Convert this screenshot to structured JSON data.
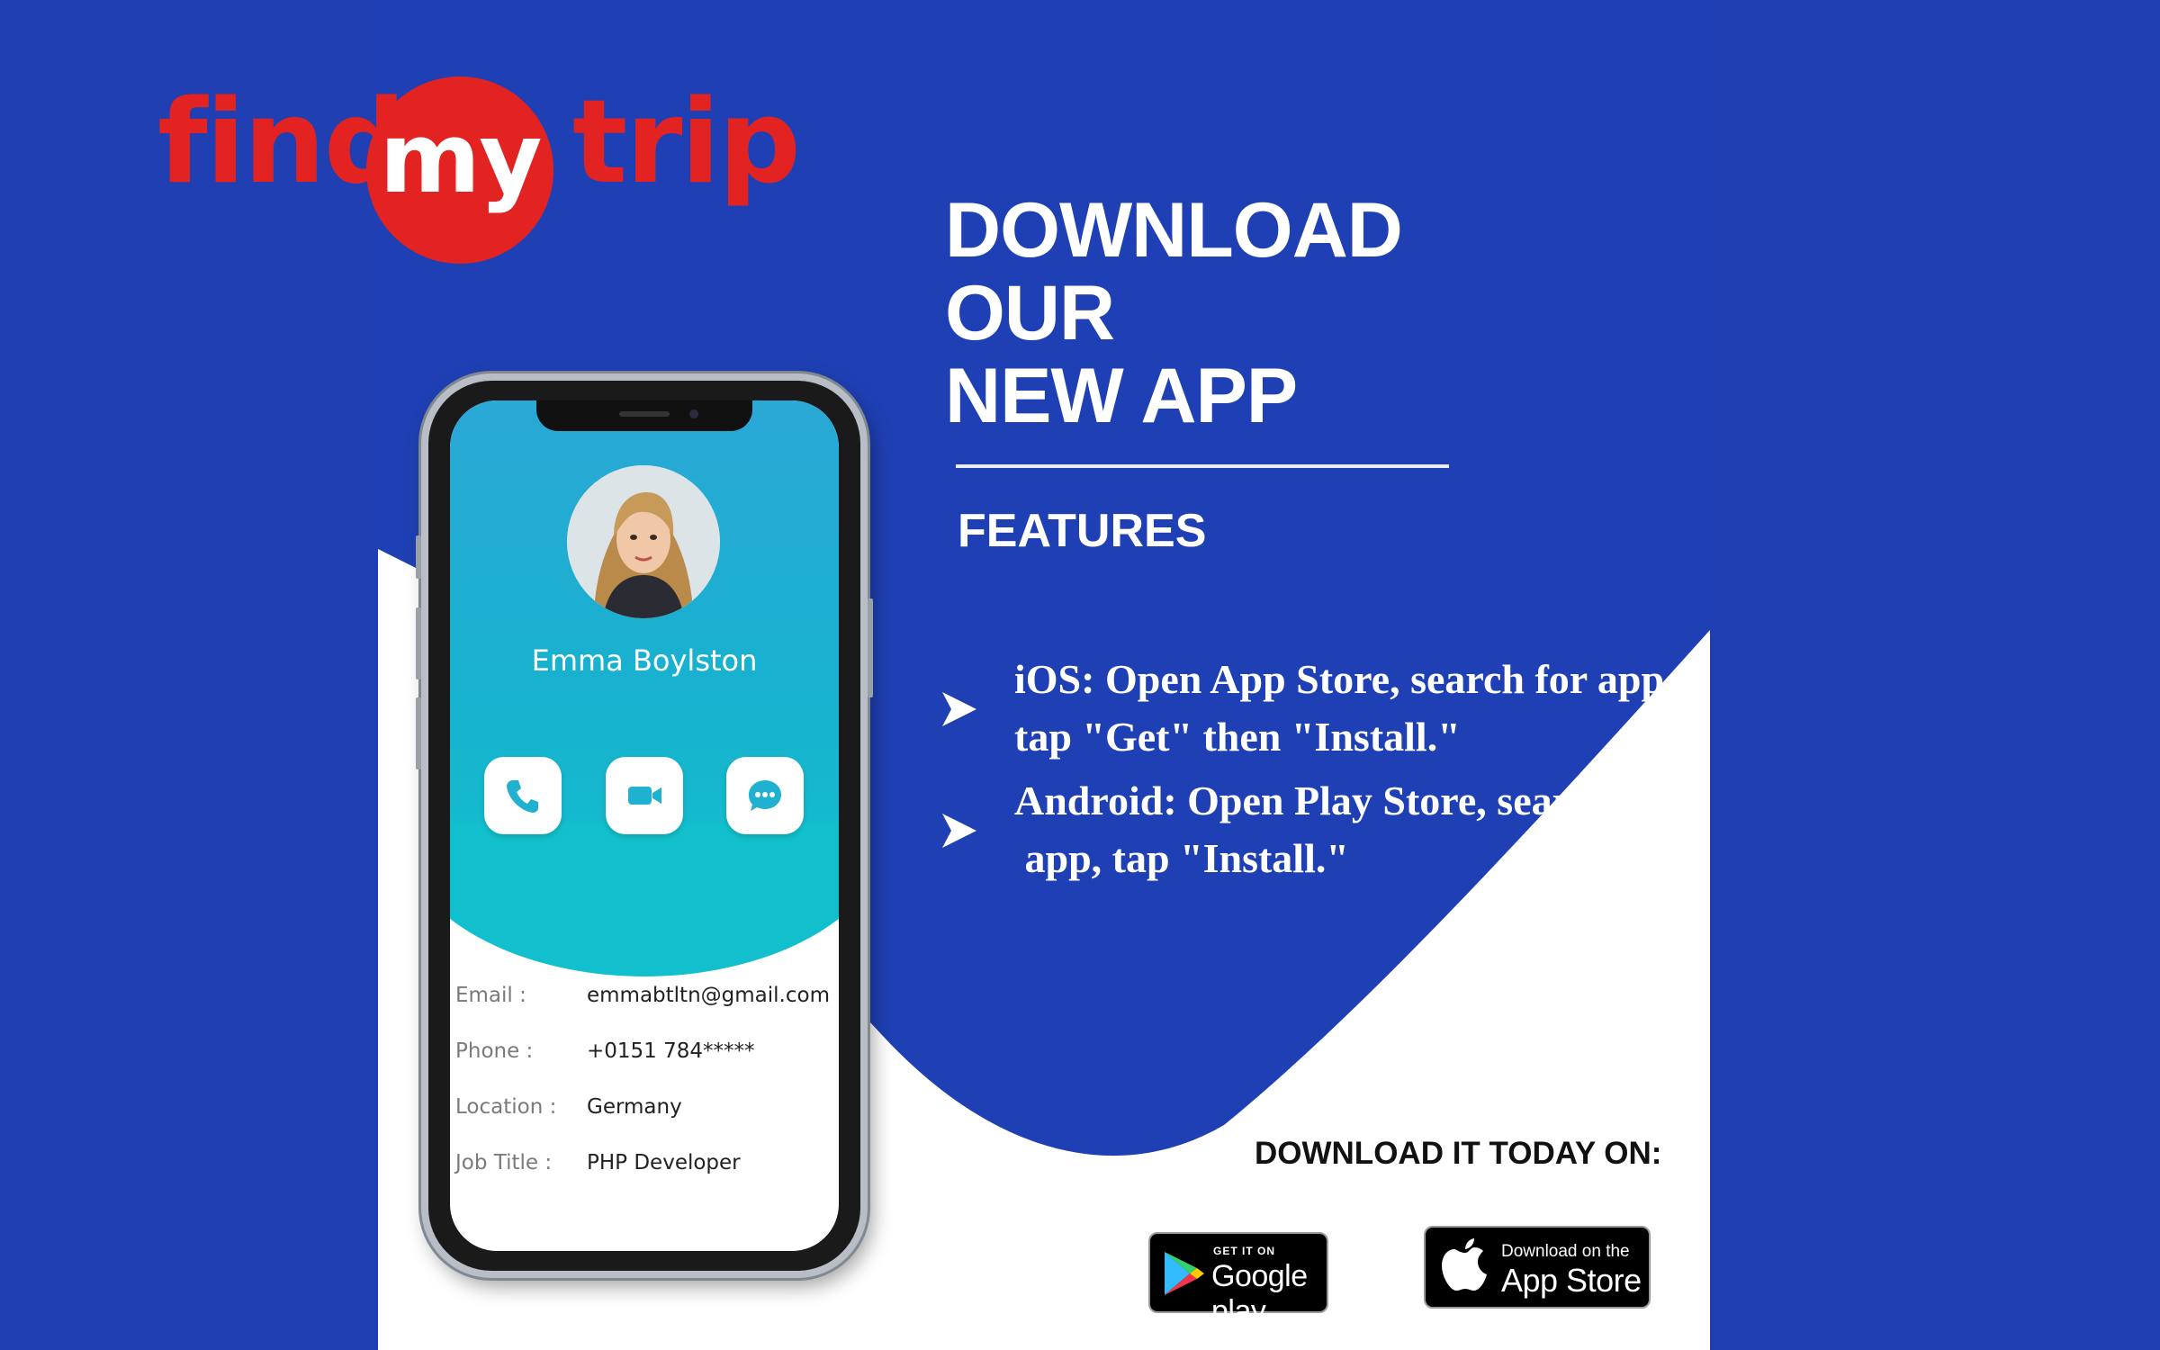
{
  "brand": {
    "word1": "find",
    "word2": "my",
    "word3": "trip",
    "color": "#e32322"
  },
  "headline": {
    "line1": "DOWNLOAD",
    "line2": "OUR",
    "line3": "NEW APP"
  },
  "features_title": "FEATURES",
  "bullets": [
    {
      "line1": "iOS: Open App Store, search for app,",
      "line2": "tap \"Get\" then \"Install.\""
    },
    {
      "line1": "Android: Open Play Store, search for",
      "line2": " app, tap \"Install.\""
    }
  ],
  "download": {
    "title": "DOWNLOAD IT TODAY ON:",
    "google": {
      "small": "GET IT ON",
      "big": "Google play"
    },
    "apple": {
      "small": "Download on the",
      "big": "App Store"
    }
  },
  "profile": {
    "name": "Emma Boylston",
    "rows": [
      {
        "label": "Email :",
        "value": "emmabtltn@gmail.com"
      },
      {
        "label": "Phone :",
        "value": "+0151 784*****"
      },
      {
        "label": "Location :",
        "value": "Germany"
      },
      {
        "label": "Job Title :",
        "value": "PHP Developer"
      }
    ],
    "actions": [
      "phone-icon",
      "video-icon",
      "chat-icon"
    ]
  },
  "colors": {
    "background": "#1f3fb3",
    "white": "#ffffff",
    "teal": "#17b2cf"
  }
}
